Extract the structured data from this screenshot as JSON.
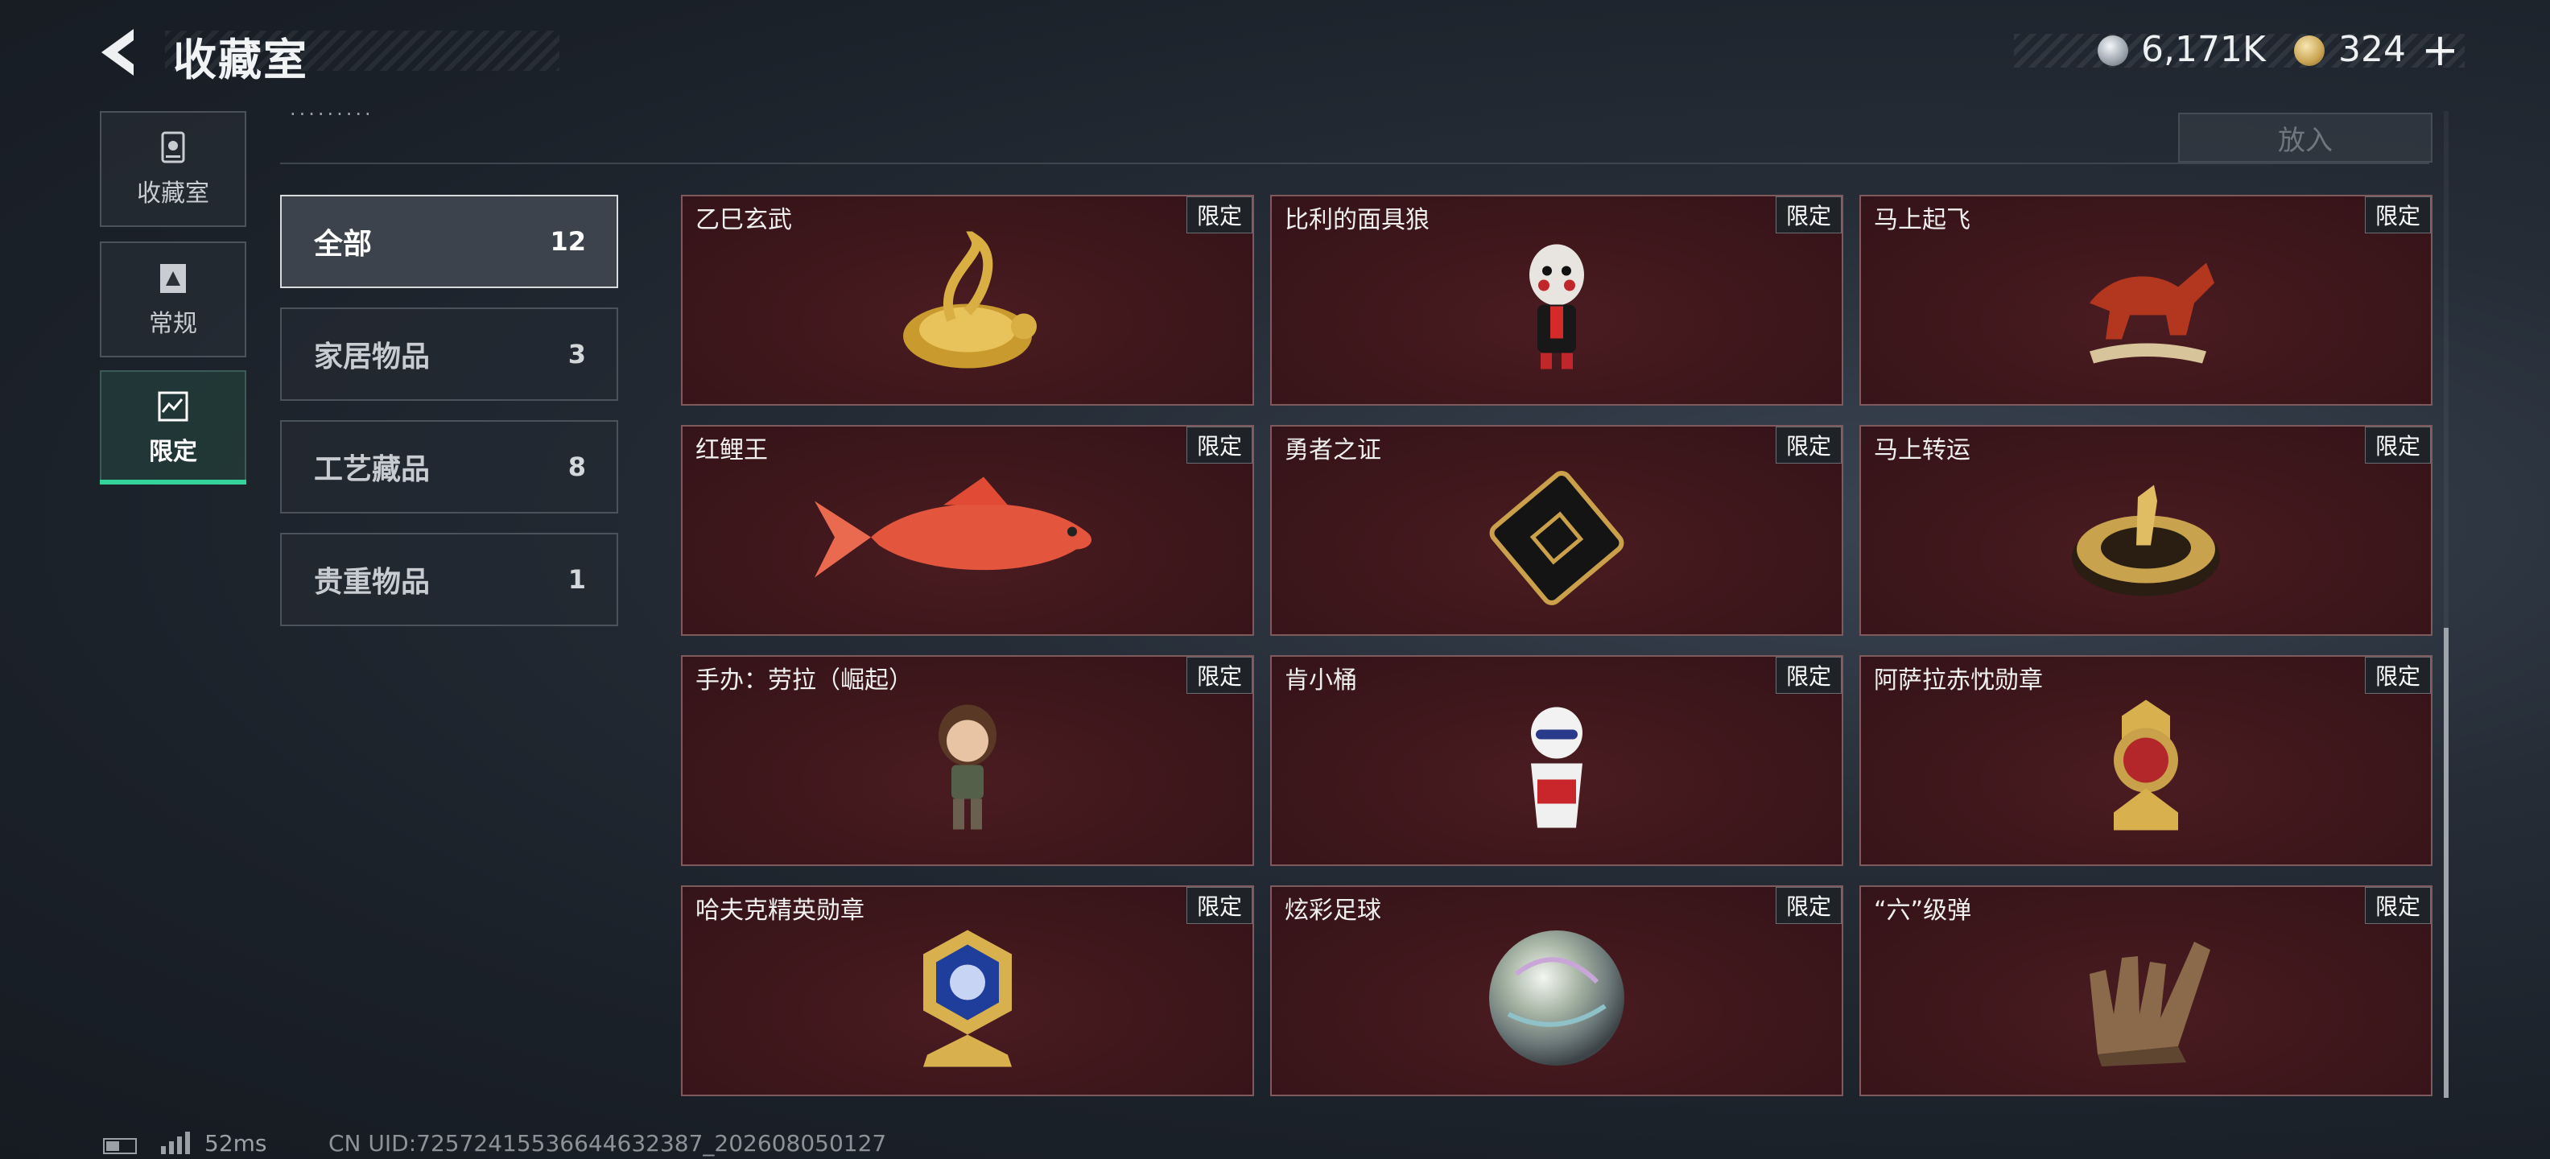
{
  "header": {
    "title": "收藏室",
    "currency": [
      {
        "icon": "silver-coin-icon",
        "value": "6,171K"
      },
      {
        "icon": "gold-coin-icon",
        "value": "324"
      }
    ],
    "add_symbol": "+"
  },
  "nav": {
    "items": [
      {
        "label": "收藏室",
        "icon": "collection-icon",
        "active": false
      },
      {
        "label": "常规",
        "icon": "regular-icon",
        "active": false
      },
      {
        "label": "限定",
        "icon": "limited-icon",
        "active": true
      }
    ]
  },
  "toolbar": {
    "put_label": "放入",
    "cut_text": "·········"
  },
  "categories": [
    {
      "name": "全部",
      "count": "12",
      "active": true
    },
    {
      "name": "家居物品",
      "count": "3",
      "active": false
    },
    {
      "name": "工艺藏品",
      "count": "8",
      "active": false
    },
    {
      "name": "贵重物品",
      "count": "1",
      "active": false
    }
  ],
  "items": [
    {
      "name": "乙巳玄武",
      "tag": "限定",
      "icon": "golden-snake-turtle-icon"
    },
    {
      "name": "比利的面具狼",
      "tag": "限定",
      "icon": "jigsaw-puppet-figure-icon"
    },
    {
      "name": "马上起飞",
      "tag": "限定",
      "icon": "red-horse-statue-icon"
    },
    {
      "name": "红鲤王",
      "tag": "限定",
      "icon": "red-carp-icon"
    },
    {
      "name": "勇者之证",
      "tag": "限定",
      "icon": "black-gold-card-icon"
    },
    {
      "name": "马上转运",
      "tag": "限定",
      "icon": "golden-horse-compass-icon"
    },
    {
      "name": "手办：劳拉（崛起）",
      "tag": "限定",
      "icon": "lara-figure-icon"
    },
    {
      "name": "肯小桶",
      "tag": "限定",
      "icon": "colonel-bucket-figure-icon"
    },
    {
      "name": "阿萨拉赤忱勋章",
      "tag": "限定",
      "icon": "red-gold-medal-icon"
    },
    {
      "name": "哈夫克精英勋章",
      "tag": "限定",
      "icon": "blue-gold-medal-icon"
    },
    {
      "name": "炫彩足球",
      "tag": "限定",
      "icon": "iridescent-ball-icon"
    },
    {
      "name": "“六”级弹",
      "tag": "限定",
      "icon": "bronze-hand-statue-icon"
    }
  ],
  "status": {
    "ping": "52ms",
    "uid": "CN UID:7257241553664463238​7_202608050127"
  },
  "colors": {
    "accent": "#35d39a",
    "card_bg": "#3a1519",
    "card_border": "#7e5a5d"
  }
}
